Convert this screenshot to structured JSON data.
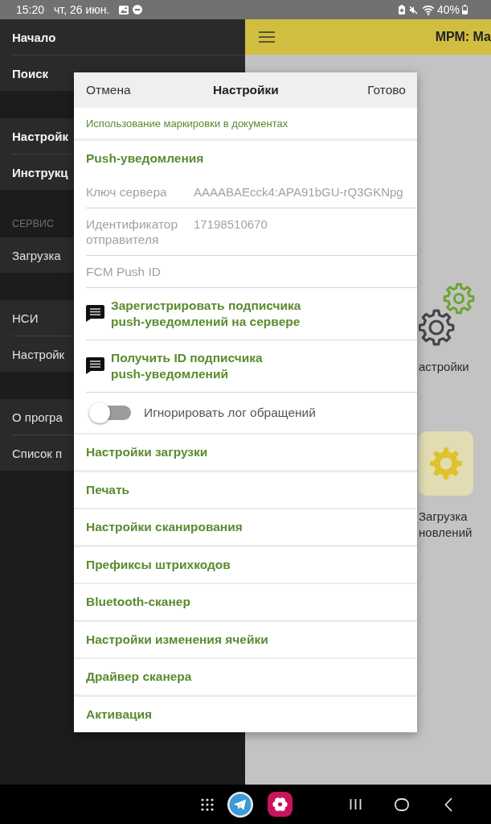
{
  "status_bar": {
    "time": "15:20",
    "date": "чт, 26 июн.",
    "battery_text": "40%"
  },
  "drawer": {
    "groups": [
      {
        "items": [
          {
            "label": "Начало",
            "kind": "primary"
          },
          {
            "label": "Поиск",
            "kind": "primary"
          }
        ]
      },
      {
        "items": [
          {
            "label": "Настройк",
            "kind": "primary"
          },
          {
            "label": "Инструкц",
            "kind": "primary"
          }
        ]
      },
      {
        "header": "СЕРВИС",
        "items": [
          {
            "label": "Загрузка",
            "kind": "secondary"
          }
        ]
      },
      {
        "items": [
          {
            "label": "НСИ",
            "kind": "secondary"
          },
          {
            "label": "Настройк",
            "kind": "secondary"
          }
        ]
      },
      {
        "items": [
          {
            "label": "О програ",
            "kind": "secondary"
          },
          {
            "label": "Список п",
            "kind": "secondary"
          }
        ]
      }
    ]
  },
  "app_bar": {
    "title": "МРМ: Ма"
  },
  "tiles": [
    {
      "kind": "settings",
      "label_lines": [
        "астройки"
      ]
    },
    {
      "kind": "updates",
      "label_lines": [
        "Загрузка",
        "новлений"
      ]
    }
  ],
  "dialog": {
    "cancel": "Отмена",
    "title": "Настройки",
    "done": "Готово",
    "sections": [
      {
        "rows": [
          {
            "kind": "note",
            "text": "Использование маркировки в документах"
          }
        ]
      },
      {
        "rows": [
          {
            "kind": "heading",
            "text": "Push-уведомления"
          },
          {
            "kind": "field",
            "label": "Ключ сервера",
            "value": "AAAABAEcck4:APA91bGU-rQ3GKNpg"
          },
          {
            "kind": "field",
            "label": "Идентификатор отправителя",
            "value": "17198510670"
          },
          {
            "kind": "field",
            "label": "FCM Push ID"
          },
          {
            "kind": "action",
            "text": "Зарегистрировать подписчика\npush-уведомлений на сервере"
          },
          {
            "kind": "action",
            "text": "Получить ID подписчика\npush-уведомлений"
          },
          {
            "kind": "toggle",
            "text": "Игнорировать лог обращений",
            "on": false
          }
        ]
      },
      {
        "rows": [
          {
            "kind": "link",
            "text": "Настройки загрузки"
          }
        ]
      },
      {
        "rows": [
          {
            "kind": "link",
            "text": "Печать"
          }
        ]
      },
      {
        "rows": [
          {
            "kind": "link",
            "text": "Настройки сканирования"
          }
        ]
      },
      {
        "rows": [
          {
            "kind": "link",
            "text": "Префиксы штрихкодов"
          }
        ]
      },
      {
        "rows": [
          {
            "kind": "link",
            "text": "Bluetooth-сканер"
          }
        ]
      },
      {
        "rows": [
          {
            "kind": "link",
            "text": "Настройки изменения ячейки"
          }
        ]
      },
      {
        "rows": [
          {
            "kind": "link",
            "text": "Драйвер сканера"
          }
        ]
      },
      {
        "rows": [
          {
            "kind": "link",
            "text": "Активация"
          }
        ]
      }
    ]
  }
}
